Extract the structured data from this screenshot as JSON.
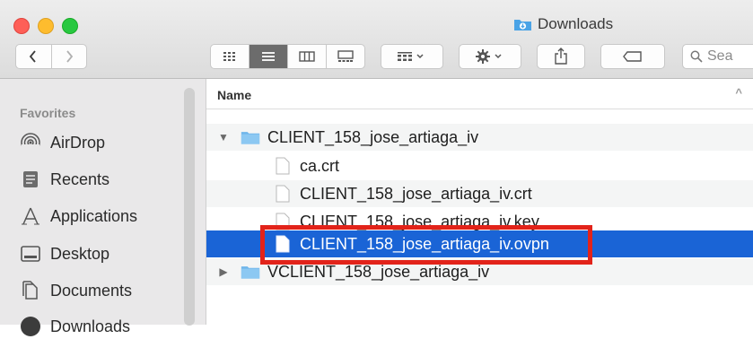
{
  "window": {
    "title": "Downloads"
  },
  "toolbar": {
    "back_icon": "chevron-left-icon",
    "forward_icon": "chevron-right-icon",
    "search_placeholder": "Sea"
  },
  "sidebar": {
    "section": "Favorites",
    "items": [
      {
        "label": "AirDrop",
        "icon": "airdrop-icon"
      },
      {
        "label": "Recents",
        "icon": "recents-icon"
      },
      {
        "label": "Applications",
        "icon": "applications-icon"
      },
      {
        "label": "Desktop",
        "icon": "desktop-icon"
      },
      {
        "label": "Documents",
        "icon": "documents-icon"
      },
      {
        "label": "Downloads",
        "icon": "downloads-icon"
      }
    ]
  },
  "list": {
    "column_name": "Name",
    "rows": [
      {
        "label": "CLIENT_158_jose_artiaga_iv",
        "type": "folder",
        "expanded": true
      },
      {
        "label": "ca.crt",
        "type": "file"
      },
      {
        "label": "CLIENT_158_jose_artiaga_iv.crt",
        "type": "file"
      },
      {
        "label": "CLIENT_158_jose_artiaga_iv.key",
        "type": "file"
      },
      {
        "label": "CLIENT_158_jose_artiaga_iv.ovpn",
        "type": "file",
        "selected": true
      },
      {
        "label": "VCLIENT_158_jose_artiaga_iv",
        "type": "folder",
        "expanded": false
      }
    ]
  },
  "colors": {
    "selection": "#1a64d6",
    "highlight_box": "#e2231a",
    "folder": "#6fb6ea"
  }
}
